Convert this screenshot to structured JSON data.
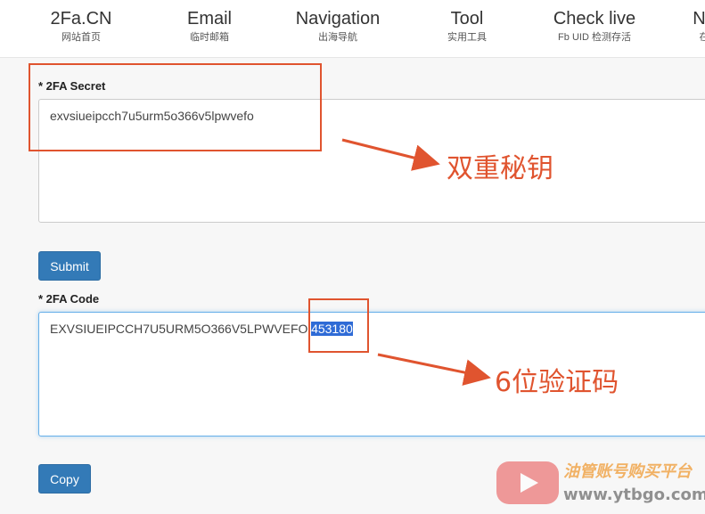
{
  "nav": {
    "items": [
      {
        "title": "2Fa.CN",
        "sub": "网站首页"
      },
      {
        "title": "Email",
        "sub": "临时邮箱"
      },
      {
        "title": "Navigation",
        "sub": "出海导航"
      },
      {
        "title": "Tool",
        "sub": "实用工具"
      },
      {
        "title": "Check live",
        "sub": "Fb UID 检测存活"
      },
      {
        "title": "No",
        "sub": "在"
      }
    ]
  },
  "form": {
    "secret_label": "* 2FA Secret",
    "secret_value": "exvsiueipcch7u5urm5o366v5lpwvefo",
    "submit_label": "Submit",
    "code_label": "* 2FA Code",
    "code_prefix": "EXVSIUEIPCCH7U5URM5O366V5LPWVEFO|",
    "code_digits": "453180",
    "copy_label": "Copy"
  },
  "annotations": {
    "secret_note": "双重秘钥",
    "code_note": "6位验证码",
    "color": "#e0542f"
  },
  "watermark": {
    "icon": "play-icon",
    "text": "油管账号购买平台",
    "url": "www.ytbgo.com"
  }
}
